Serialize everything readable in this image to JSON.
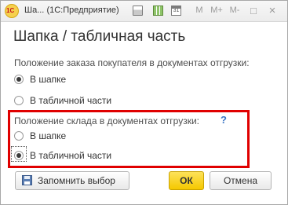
{
  "titlebar": {
    "short_title": "Ша...",
    "app_name": "(1С:Предприятие)",
    "app_icon_text": "1С",
    "calendar_icon_text": "31",
    "memory_buttons": [
      "M",
      "M+",
      "M-"
    ],
    "window_buttons": [
      "□",
      "×"
    ]
  },
  "dialog": {
    "title": "Шапка / табличная часть"
  },
  "customer_order": {
    "label": "Положение заказа покупателя в документах отгрузки:",
    "options": [
      {
        "label": "В шапке",
        "selected": true
      },
      {
        "label": "В табличной части",
        "selected": false
      }
    ]
  },
  "warehouse": {
    "label": "Положение склада в документах отгрузки:",
    "help": "?",
    "options": [
      {
        "label": "В шапке",
        "selected": false
      },
      {
        "label": "В табличной части",
        "selected": true
      }
    ]
  },
  "buttons": {
    "remember": "Запомнить выбор",
    "ok": "ОК",
    "cancel": "Отмена"
  },
  "colors": {
    "highlight": "#e00000",
    "ok_button": "#f5c800",
    "help_link": "#3a75c4"
  }
}
